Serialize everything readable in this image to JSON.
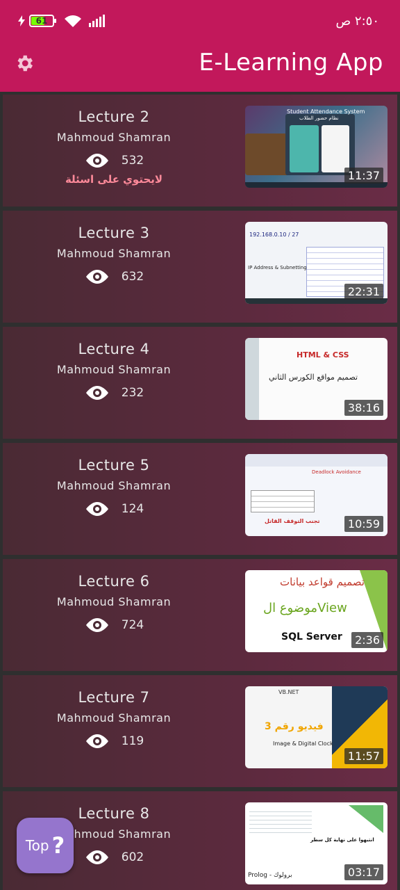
{
  "status": {
    "battery": "61",
    "time": "٢:٥٠ ص"
  },
  "app": {
    "title": "E-Learning App"
  },
  "lectures": [
    {
      "title": "Lecture 2",
      "author": "Mahmoud Shamran",
      "views": "532",
      "note": "لايحتوي على اسئلة",
      "duration": "11:37",
      "thumb": {
        "line1": "Student Attendance System",
        "line2": "نظام حضور الطلاب"
      }
    },
    {
      "title": "Lecture 3",
      "author": "Mahmoud Shamran",
      "views": "632",
      "duration": "22:31",
      "thumb": {
        "line1": "192.168.0.10 / 27",
        "line2": "IP Address & Subnetting"
      }
    },
    {
      "title": "Lecture 4",
      "author": "Mahmoud Shamran",
      "views": "232",
      "duration": "38:16",
      "thumb": {
        "line1": "HTML & CSS",
        "line2": "تصميم مواقع الكورس الثاني"
      }
    },
    {
      "title": "Lecture 5",
      "author": "Mahmoud Shamran",
      "views": "124",
      "duration": "10:59",
      "thumb": {
        "line1": "Deadlock Avoidance",
        "line2": "تجنب التوقف القاتل"
      }
    },
    {
      "title": "Lecture 6",
      "author": "Mahmoud Shamran",
      "views": "724",
      "duration": "2:36",
      "thumb": {
        "line1": "تصميم قواعد بيانات",
        "line2": "موضوع الView",
        "line3": "SQL Server"
      }
    },
    {
      "title": "Lecture 7",
      "author": "Mahmoud Shamran",
      "views": "119",
      "duration": "11:57",
      "thumb": {
        "line1": "VB.NET",
        "line2": "فيديو رقم 3",
        "line3": "Image & Digital Clock"
      }
    },
    {
      "title": "Lecture 8",
      "author": "Mahmoud Shamran",
      "views": "602",
      "duration": "03:17",
      "thumb": {
        "line1": "Prolog - برولوك",
        "line2": "انتبهوا على نهاية كل سطر"
      }
    }
  ],
  "fab": {
    "label": "Top",
    "icon": "?"
  },
  "colors": {
    "appbar": "#c2185b",
    "card": "#5c2a3e",
    "fab": "#9575cd"
  }
}
